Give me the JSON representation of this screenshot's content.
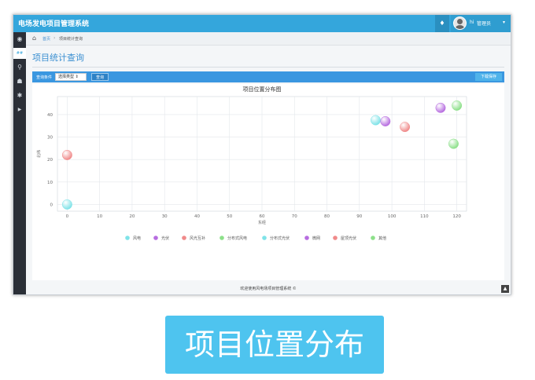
{
  "header": {
    "app_title": "电场发电项目管理系统",
    "bell_icon": "bell-icon",
    "user_greeting": "hi",
    "user_name": "管理员",
    "caret": "▾"
  },
  "sidebar": {
    "items": [
      {
        "icon": "dashboard-icon",
        "glyph": "◉"
      },
      {
        "icon": "active-tab-icon",
        "glyph": "##"
      },
      {
        "icon": "location-icon",
        "glyph": "⚲"
      },
      {
        "icon": "user-icon",
        "glyph": "☗"
      },
      {
        "icon": "gear-icon",
        "glyph": "✱"
      },
      {
        "icon": "play-icon",
        "glyph": "▶"
      }
    ]
  },
  "breadcrumb": {
    "home": "首页",
    "separator": "›",
    "current": "项目统计查询"
  },
  "page": {
    "title": "项目统计查询"
  },
  "query": {
    "label": "查询条件",
    "select_value": "选择类型",
    "search_button": "查询",
    "save_button": "下载保存"
  },
  "chart_data": {
    "type": "scatter",
    "title": "项目位置分布图",
    "xlabel": "东经",
    "ylabel": "北纬",
    "xlim": [
      -3,
      123
    ],
    "ylim": [
      -3,
      48
    ],
    "xticks": [
      0,
      10,
      20,
      30,
      40,
      50,
      60,
      70,
      80,
      90,
      100,
      110,
      120
    ],
    "yticks": [
      0,
      10,
      20,
      30,
      40
    ],
    "grid": true,
    "legend_position": "bottom",
    "series": [
      {
        "name": "风电",
        "color": "#7fe3e8",
        "points": [
          [
            0,
            0
          ],
          [
            95,
            37.5
          ]
        ]
      },
      {
        "name": "光伏",
        "color": "#b76de0",
        "points": [
          [
            98,
            37
          ]
        ]
      },
      {
        "name": "风光互补",
        "color": "#f08a8a",
        "points": [
          [
            104,
            34.5
          ]
        ]
      },
      {
        "name": "分布式风电",
        "color": "#8de08a",
        "points": [
          [
            119,
            27
          ]
        ]
      },
      {
        "name": "分布式光伏",
        "color": "#7fe3e8",
        "points": []
      },
      {
        "name": "微网",
        "color": "#b76de0",
        "points": [
          [
            115,
            43
          ]
        ]
      },
      {
        "name": "屋顶光伏",
        "color": "#f08a8a",
        "points": [
          [
            0,
            22
          ]
        ]
      },
      {
        "name": "其他",
        "color": "#8de08a",
        "points": [
          [
            120,
            44
          ]
        ]
      }
    ]
  },
  "footer": {
    "text": "欢迎使用风电场项目管理系统  ©",
    "back_top": "▲"
  },
  "caption": {
    "text": "项目位置分布"
  }
}
